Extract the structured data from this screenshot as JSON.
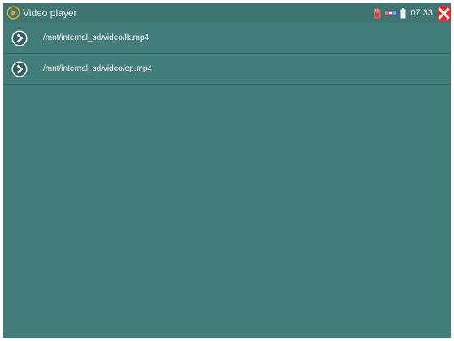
{
  "app": {
    "title": "Video player",
    "icon": "play-circle-icon"
  },
  "status": {
    "time": "07:33",
    "icons": [
      "sd-card-icon",
      "network-icon",
      "battery-icon",
      "close-icon"
    ],
    "close_color": "#e02a2a",
    "accent": "#e0a830"
  },
  "files": [
    {
      "path": "/mnt/internal_sd/video/lk.mp4",
      "icon": "play-arrow-icon"
    },
    {
      "path": "/mnt/internal_sd/video/op.mp4",
      "icon": "play-arrow-icon"
    }
  ],
  "colors": {
    "background": "#437d79",
    "statusbar": "#3f7672",
    "divider": "#2f6461"
  }
}
